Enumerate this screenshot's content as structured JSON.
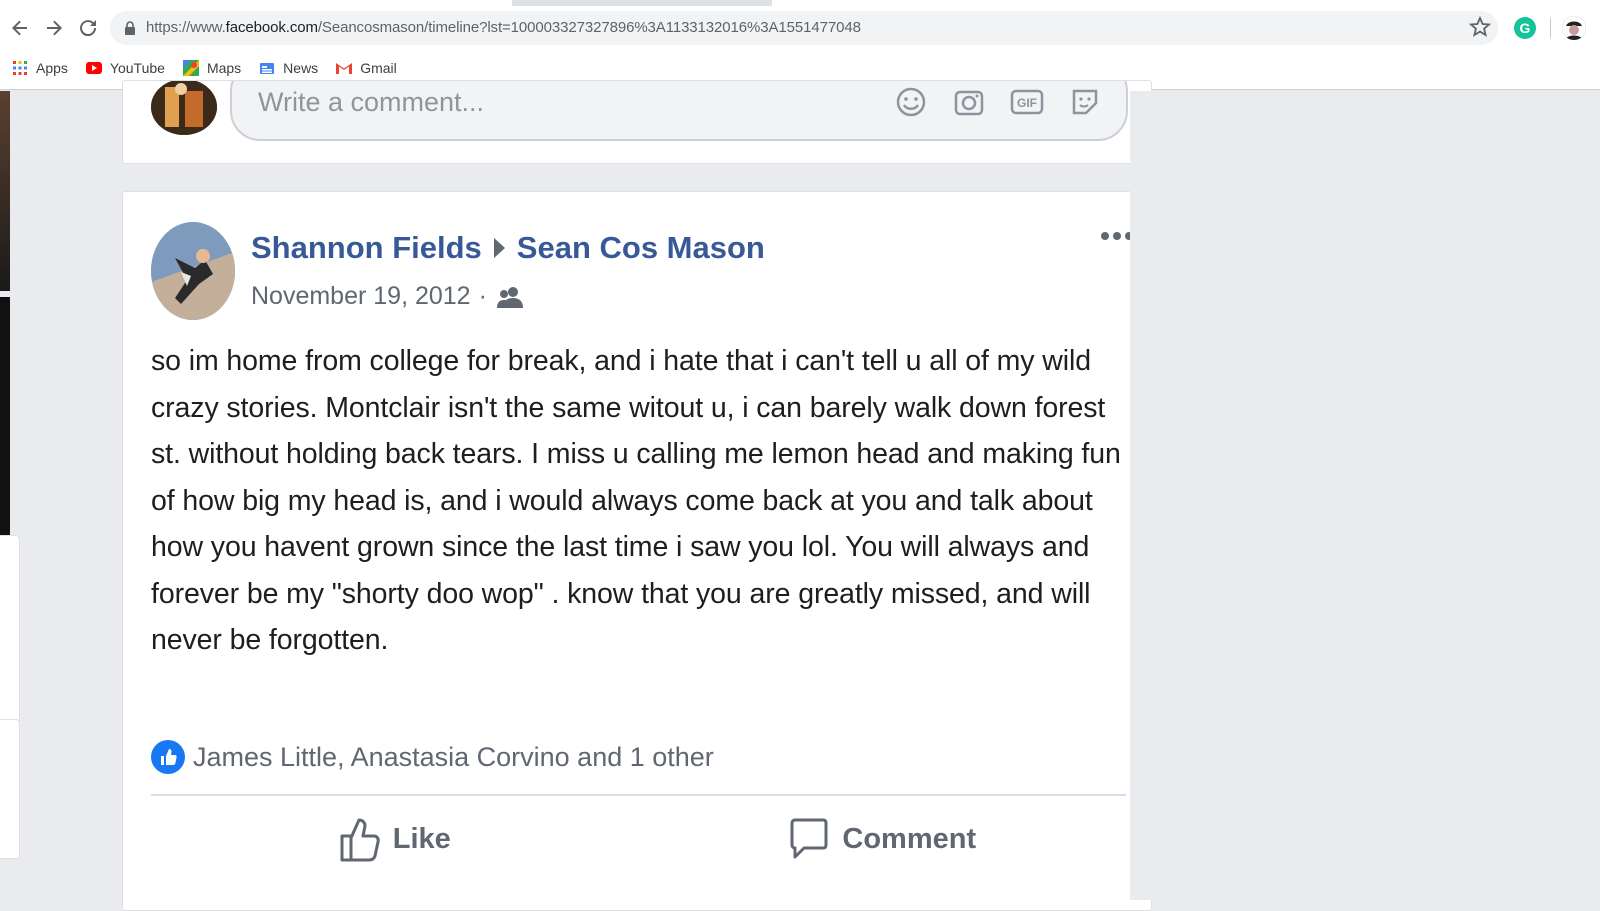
{
  "browser": {
    "url_prefix": "https://www.",
    "url_host": "facebook.com",
    "url_path": "/Seancosmason/timeline?lst=100003327327896%3A1133132016%3A1551477048",
    "extension_letter": "G"
  },
  "bookmarks": [
    {
      "label": "Apps",
      "icon": "apps-grid-icon"
    },
    {
      "label": "YouTube",
      "icon": "youtube-icon"
    },
    {
      "label": "Maps",
      "icon": "maps-icon"
    },
    {
      "label": "News",
      "icon": "news-icon"
    },
    {
      "label": "Gmail",
      "icon": "gmail-icon"
    }
  ],
  "comment_composer": {
    "placeholder": "Write a comment..."
  },
  "post": {
    "author": "Shannon Fields",
    "target": "Sean Cos Mason",
    "date": "November 19, 2012",
    "separator": "·",
    "audience": "friends-icon",
    "text": "so im home from college for break, and i hate that i can't tell u all of my wild crazy stories. Montclair isn't the same witout u, i can barely walk down forest st. without holding back tears. I miss u calling me lemon head and making fun of how big my head is, and i would always come back at you and talk about how you havent grown since the last time i saw you lol. You will always and forever be my \"shorty doo wop\" . know that you are greatly missed, and will never be forgotten.",
    "reactions_summary": "James Little, Anastasia Corvino and 1 other",
    "actions": {
      "like": "Like",
      "comment": "Comment"
    }
  },
  "colors": {
    "link_blue": "#385898",
    "like_blue": "#1877f2",
    "background": "#e9ebee"
  }
}
